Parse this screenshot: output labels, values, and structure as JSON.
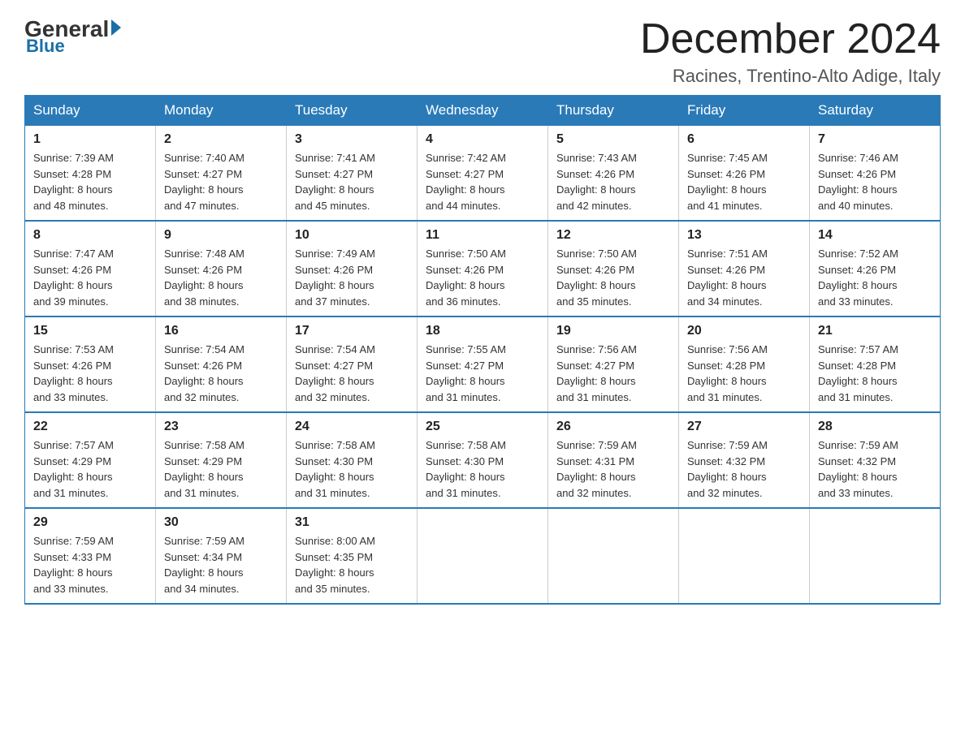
{
  "header": {
    "logo_general": "General",
    "logo_blue": "Blue",
    "month_title": "December 2024",
    "location": "Racines, Trentino-Alto Adige, Italy"
  },
  "days_of_week": [
    "Sunday",
    "Monday",
    "Tuesday",
    "Wednesday",
    "Thursday",
    "Friday",
    "Saturday"
  ],
  "weeks": [
    [
      {
        "day": "1",
        "sunrise": "7:39 AM",
        "sunset": "4:28 PM",
        "daylight": "8 hours and 48 minutes."
      },
      {
        "day": "2",
        "sunrise": "7:40 AM",
        "sunset": "4:27 PM",
        "daylight": "8 hours and 47 minutes."
      },
      {
        "day": "3",
        "sunrise": "7:41 AM",
        "sunset": "4:27 PM",
        "daylight": "8 hours and 45 minutes."
      },
      {
        "day": "4",
        "sunrise": "7:42 AM",
        "sunset": "4:27 PM",
        "daylight": "8 hours and 44 minutes."
      },
      {
        "day": "5",
        "sunrise": "7:43 AM",
        "sunset": "4:26 PM",
        "daylight": "8 hours and 42 minutes."
      },
      {
        "day": "6",
        "sunrise": "7:45 AM",
        "sunset": "4:26 PM",
        "daylight": "8 hours and 41 minutes."
      },
      {
        "day": "7",
        "sunrise": "7:46 AM",
        "sunset": "4:26 PM",
        "daylight": "8 hours and 40 minutes."
      }
    ],
    [
      {
        "day": "8",
        "sunrise": "7:47 AM",
        "sunset": "4:26 PM",
        "daylight": "8 hours and 39 minutes."
      },
      {
        "day": "9",
        "sunrise": "7:48 AM",
        "sunset": "4:26 PM",
        "daylight": "8 hours and 38 minutes."
      },
      {
        "day": "10",
        "sunrise": "7:49 AM",
        "sunset": "4:26 PM",
        "daylight": "8 hours and 37 minutes."
      },
      {
        "day": "11",
        "sunrise": "7:50 AM",
        "sunset": "4:26 PM",
        "daylight": "8 hours and 36 minutes."
      },
      {
        "day": "12",
        "sunrise": "7:50 AM",
        "sunset": "4:26 PM",
        "daylight": "8 hours and 35 minutes."
      },
      {
        "day": "13",
        "sunrise": "7:51 AM",
        "sunset": "4:26 PM",
        "daylight": "8 hours and 34 minutes."
      },
      {
        "day": "14",
        "sunrise": "7:52 AM",
        "sunset": "4:26 PM",
        "daylight": "8 hours and 33 minutes."
      }
    ],
    [
      {
        "day": "15",
        "sunrise": "7:53 AM",
        "sunset": "4:26 PM",
        "daylight": "8 hours and 33 minutes."
      },
      {
        "day": "16",
        "sunrise": "7:54 AM",
        "sunset": "4:26 PM",
        "daylight": "8 hours and 32 minutes."
      },
      {
        "day": "17",
        "sunrise": "7:54 AM",
        "sunset": "4:27 PM",
        "daylight": "8 hours and 32 minutes."
      },
      {
        "day": "18",
        "sunrise": "7:55 AM",
        "sunset": "4:27 PM",
        "daylight": "8 hours and 31 minutes."
      },
      {
        "day": "19",
        "sunrise": "7:56 AM",
        "sunset": "4:27 PM",
        "daylight": "8 hours and 31 minutes."
      },
      {
        "day": "20",
        "sunrise": "7:56 AM",
        "sunset": "4:28 PM",
        "daylight": "8 hours and 31 minutes."
      },
      {
        "day": "21",
        "sunrise": "7:57 AM",
        "sunset": "4:28 PM",
        "daylight": "8 hours and 31 minutes."
      }
    ],
    [
      {
        "day": "22",
        "sunrise": "7:57 AM",
        "sunset": "4:29 PM",
        "daylight": "8 hours and 31 minutes."
      },
      {
        "day": "23",
        "sunrise": "7:58 AM",
        "sunset": "4:29 PM",
        "daylight": "8 hours and 31 minutes."
      },
      {
        "day": "24",
        "sunrise": "7:58 AM",
        "sunset": "4:30 PM",
        "daylight": "8 hours and 31 minutes."
      },
      {
        "day": "25",
        "sunrise": "7:58 AM",
        "sunset": "4:30 PM",
        "daylight": "8 hours and 31 minutes."
      },
      {
        "day": "26",
        "sunrise": "7:59 AM",
        "sunset": "4:31 PM",
        "daylight": "8 hours and 32 minutes."
      },
      {
        "day": "27",
        "sunrise": "7:59 AM",
        "sunset": "4:32 PM",
        "daylight": "8 hours and 32 minutes."
      },
      {
        "day": "28",
        "sunrise": "7:59 AM",
        "sunset": "4:32 PM",
        "daylight": "8 hours and 33 minutes."
      }
    ],
    [
      {
        "day": "29",
        "sunrise": "7:59 AM",
        "sunset": "4:33 PM",
        "daylight": "8 hours and 33 minutes."
      },
      {
        "day": "30",
        "sunrise": "7:59 AM",
        "sunset": "4:34 PM",
        "daylight": "8 hours and 34 minutes."
      },
      {
        "day": "31",
        "sunrise": "8:00 AM",
        "sunset": "4:35 PM",
        "daylight": "8 hours and 35 minutes."
      },
      null,
      null,
      null,
      null
    ]
  ],
  "labels": {
    "sunrise": "Sunrise:",
    "sunset": "Sunset:",
    "daylight": "Daylight:"
  }
}
